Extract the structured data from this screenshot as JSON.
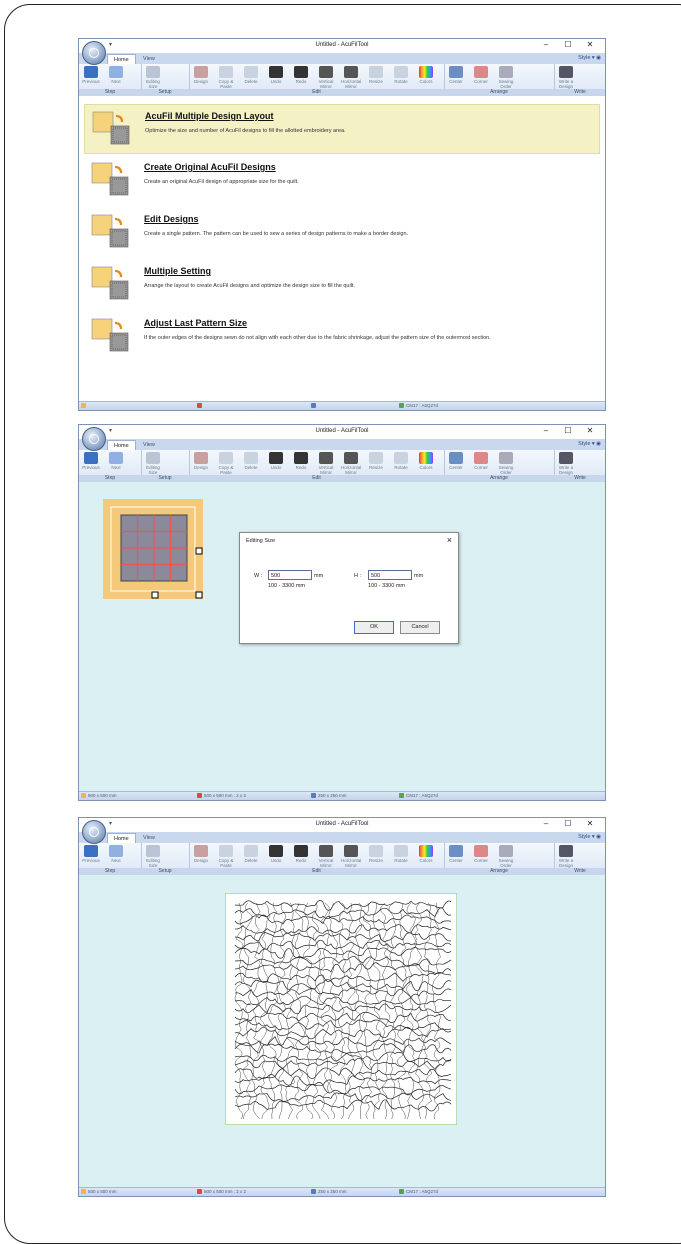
{
  "app": {
    "title": "Untitled - AcuFilTool",
    "qat": "▾",
    "window_controls": [
      "–",
      "☐",
      "✕"
    ],
    "tabs": [
      "Home",
      "View"
    ],
    "style_menu": "Style ▾ ◉"
  },
  "ribbon": {
    "groups": [
      {
        "label": "Step",
        "buttons": [
          "Previous",
          "Next"
        ]
      },
      {
        "label": "Setup",
        "buttons": [
          "Editing Size"
        ]
      },
      {
        "label": "Edit",
        "buttons": [
          "Design",
          "Copy & Paste",
          "Delete",
          "Undo",
          "Redo",
          "Vertical Mirror",
          "Horizontal Mirror",
          "Resize",
          "Rotate",
          "Colors"
        ]
      },
      {
        "label": "Arrange",
        "buttons": [
          "Center",
          "Corner",
          "Sewing Order"
        ]
      },
      {
        "label": "Write",
        "buttons": [
          "Write a Design"
        ]
      }
    ]
  },
  "screen1": {
    "items": [
      {
        "title": "AcuFil Multiple Design Layout",
        "desc": "Optimize the size and number of AcuFil designs to fill the allotted embroidery area."
      },
      {
        "title": "Create Original AcuFil Designs",
        "desc": "Create an original AcuFil design of appropriate size for the quilt."
      },
      {
        "title": "Edit Designs",
        "desc": "Create a single pattern. The pattern can be used to sew a series of design patterns to make a border design."
      },
      {
        "title": "Multiple Setting",
        "desc": "Arrange the layout to create AcuFil designs and optimize the design size to fill the quilt."
      },
      {
        "title": "Adjust Last Pattern Size",
        "desc": "If the outer edges of the designs sewn do not align with each other due to the fabric shrinkage, adjust the pattern size of the outermost section."
      }
    ],
    "status": {
      "machine": "CM17 : A5Q27d"
    }
  },
  "screen2": {
    "dialog": {
      "title": "Editing Size",
      "w_label": "W :",
      "w_value": "500",
      "w_unit": "mm",
      "w_range": "100 - 3300 mm",
      "h_label": "H :",
      "h_value": "500",
      "h_unit": "mm",
      "h_range": "100 - 3300 mm",
      "ok": "OK",
      "cancel": "Cancel"
    },
    "status": {
      "size": "500 x 500 mm",
      "grid": "500 x 500 mm : 2 x 2",
      "design": "250 x 250 mm",
      "machine": "CM17 : A5Q27d"
    }
  },
  "screen3": {
    "status": {
      "size": "500 x 500 mm",
      "grid": "500 x 500 mm : 2 x 2",
      "design": "250 x 250 mm",
      "machine": "CM17 : A5Q27d"
    }
  },
  "colors": {
    "accent": "#2b4b88",
    "canvas": "#daf0f3",
    "highlight": "#f4f1c4",
    "frame_orange": "#f5c97a"
  }
}
